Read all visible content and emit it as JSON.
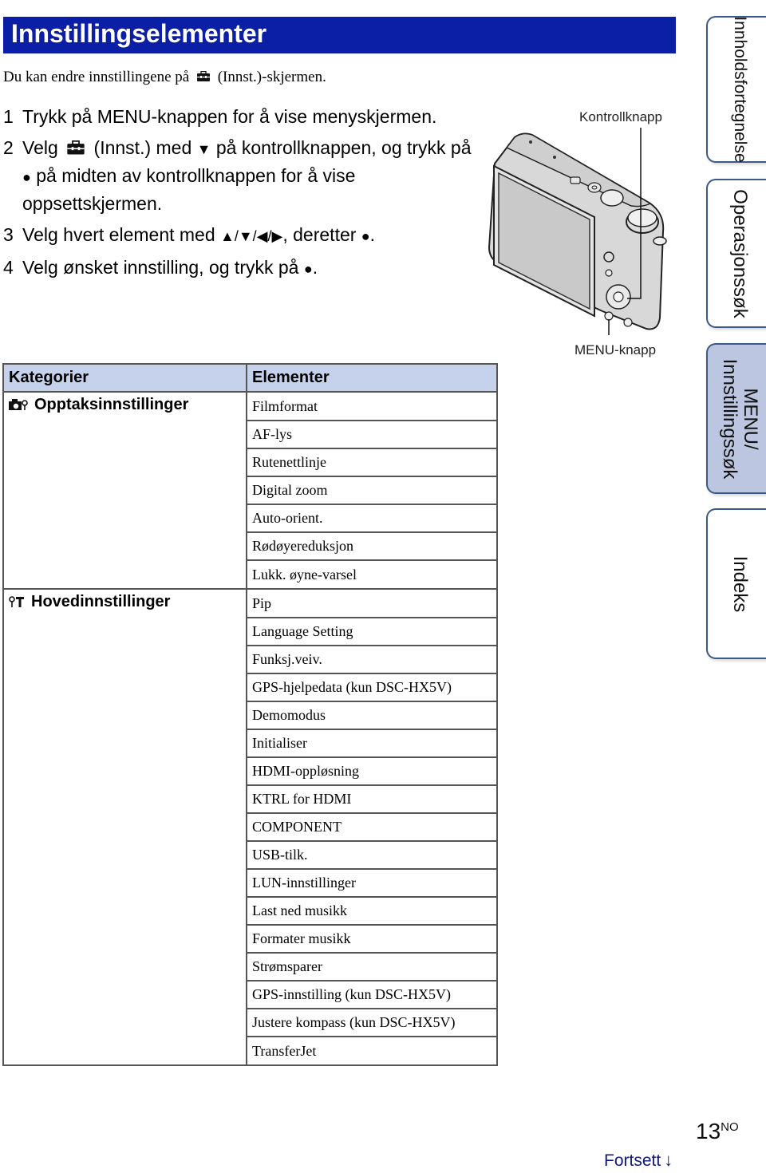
{
  "header": {
    "title": "Innstillingselementer"
  },
  "intro": {
    "before_icon": "Du kan endre innstillingene på",
    "icon": "toolbox-icon",
    "after_icon": "(Innst.)-skjermen."
  },
  "steps": [
    {
      "num": "1",
      "text": "Trykk på MENU-knappen for å vise menyskjermen."
    },
    {
      "num": "2",
      "parts": [
        "Velg",
        "(Innst.) med",
        "▼",
        "på kontrollknappen, og trykk på",
        "●",
        "på midten av kontrollknappen for å vise oppsettskjermen."
      ]
    },
    {
      "num": "3",
      "parts": [
        "Velg hvert element med",
        "▲/▼/◀/▶",
        ", deretter",
        "●",
        "."
      ]
    },
    {
      "num": "4",
      "parts": [
        "Velg ønsket innstilling, og trykk på",
        "●",
        "."
      ]
    }
  ],
  "figure": {
    "callouts": {
      "control_button": "Kontrollknapp",
      "menu_button": "MENU-knapp"
    }
  },
  "table": {
    "headers": {
      "category": "Kategorier",
      "items": "Elementer"
    },
    "categories": [
      {
        "label": "Opptaksinnstillinger",
        "icon": "camera-settings-icon",
        "items": [
          "Filmformat",
          "AF-lys",
          "Rutenettlinje",
          "Digital zoom",
          "Auto-orient.",
          "Rødøyereduksjon",
          "Lukk. øyne-varsel"
        ]
      },
      {
        "label": "Hovedinnstillinger",
        "icon": "main-settings-icon",
        "items": [
          "Pip",
          "Language Setting",
          "Funksj.veiv.",
          "GPS-hjelpedata (kun DSC-HX5V)",
          "Demomodus",
          "Initialiser",
          "HDMI-oppløsning",
          "KTRL for HDMI",
          "COMPONENT",
          "USB-tilk.",
          "LUN-innstillinger",
          "Last ned musikk",
          "Formater musikk",
          "Strømsparer",
          "GPS-innstilling (kun DSC-HX5V)",
          "Justere kompass (kun DSC-HX5V)",
          "TransferJet"
        ]
      }
    ]
  },
  "side_tabs": [
    {
      "label": "Innholdsfortegnelse",
      "active": false
    },
    {
      "label": "Operasjonssøk",
      "active": false
    },
    {
      "label_line1": "MENU/",
      "label_line2": "Innstillingssøk",
      "active": true
    },
    {
      "label": "Indeks",
      "active": false
    }
  ],
  "footer": {
    "page_number": "13",
    "page_suffix": "NO",
    "continue_label": "Fortsett",
    "continue_icon": "↓"
  },
  "colors": {
    "title_bg": "#0b1ea6",
    "table_header_bg": "#c6d2ec",
    "active_tab_bg": "#bcc6e0",
    "continue_text": "#10187a"
  }
}
